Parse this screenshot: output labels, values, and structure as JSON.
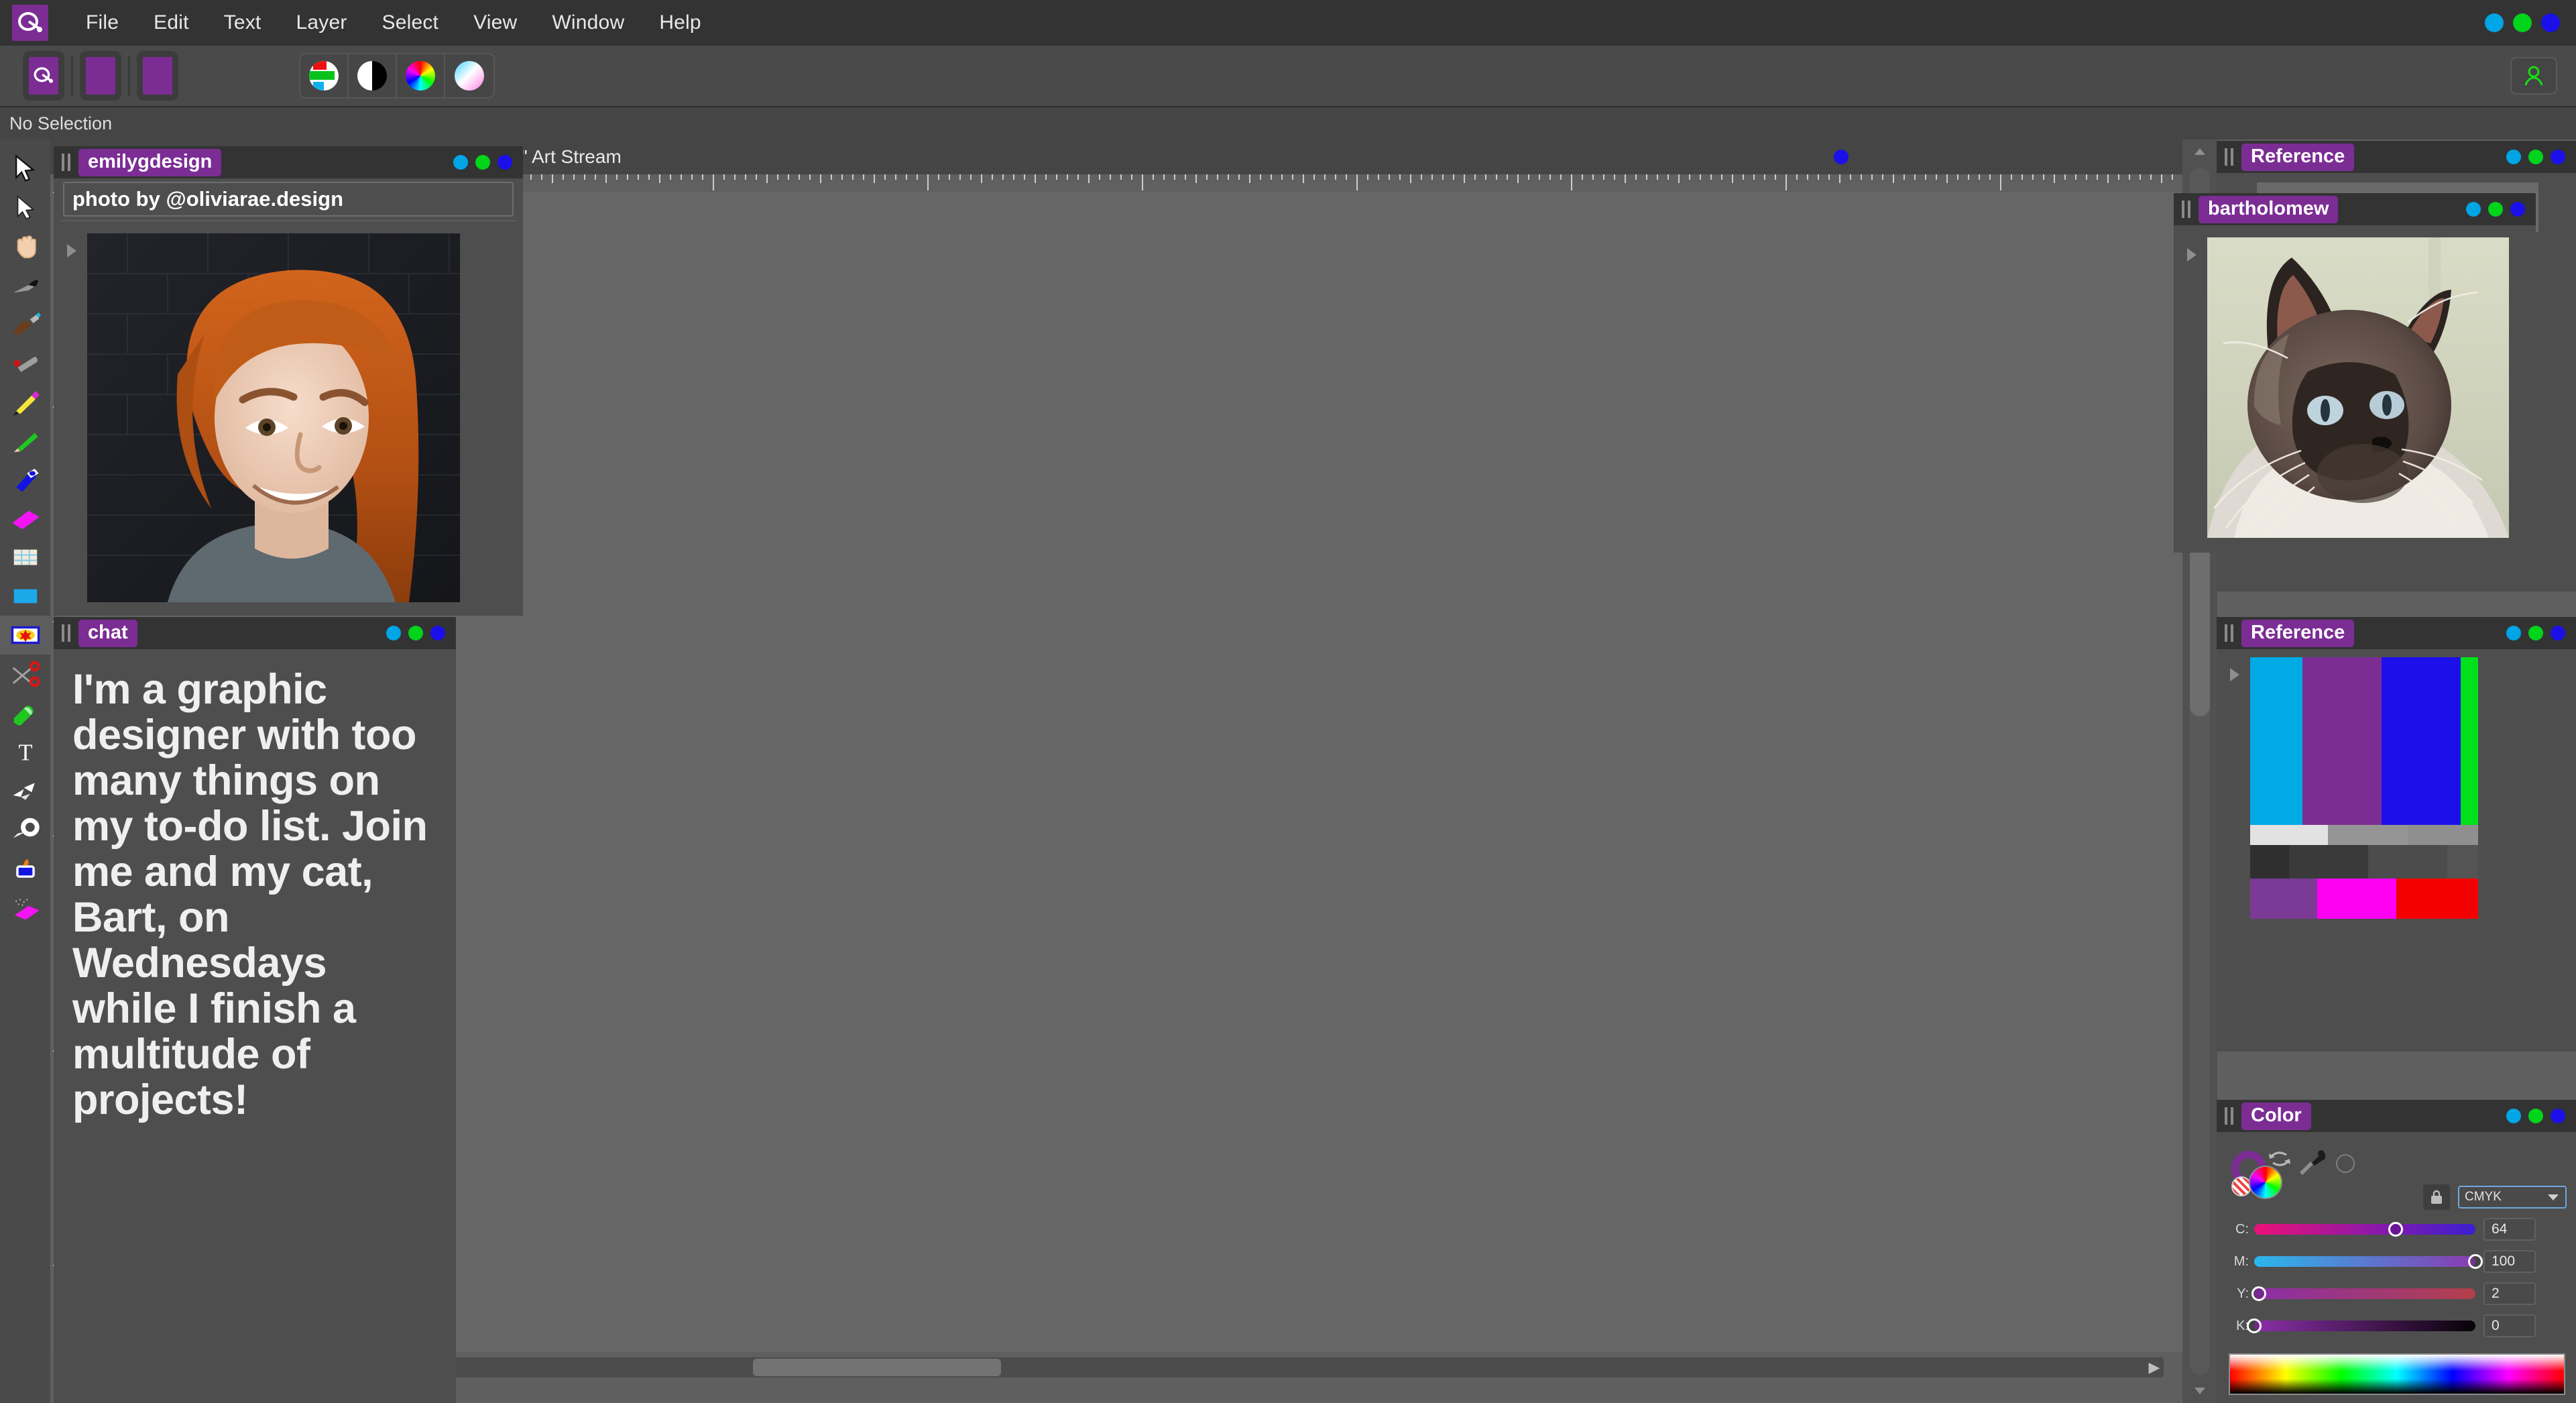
{
  "app": {
    "logo_icon": "e-plug-logo-icon",
    "menus": [
      "File",
      "Edit",
      "Text",
      "Layer",
      "Select",
      "View",
      "Window",
      "Help"
    ],
    "window_controls": [
      "minimize-dot",
      "maximize-dot",
      "close-dot"
    ],
    "accent": "#7b2d94",
    "dot_cyan": "#00a5e6",
    "dot_green": "#00d41b",
    "dot_blue": "#1b10ea"
  },
  "options_bar": {
    "presets": [
      "logo-preset",
      "purple-preset-1",
      "purple-preset-2"
    ],
    "color_modes": [
      "rgb-swatch-icon",
      "grayscale-icon",
      "color-wheel-icon",
      "gradient-icon"
    ],
    "user_icon": "user-account-icon"
  },
  "context_bar": {
    "selection_status": "No Selection"
  },
  "toolbar": {
    "tools": [
      "move-arrow-tool",
      "direct-select-arrow-tool",
      "hand-tool",
      "knife-tool",
      "paint-brush-tool",
      "charcoal-tool",
      "pencil-tool",
      "green-pencil-tool",
      "marker-tool",
      "magenta-chalk-tool",
      "grid-pattern-tool",
      "fill-rect-tool",
      "sticker-tool",
      "scissors-tool",
      "eraser-tool",
      "type-tool",
      "origami-tool",
      "lasso-tool",
      "ink-bottle-tool",
      "spray-tool"
    ],
    "selected": "sticker-tool"
  },
  "document": {
    "title": "al\" Art Stream",
    "ruler_units": "px",
    "window_controls": [
      "minimize-dot",
      "maximize-dot",
      "close-dot"
    ]
  },
  "panels": {
    "emily": {
      "title": "emilygdesign",
      "caption": "photo by @oliviarae.design",
      "media": "portrait-photo"
    },
    "chat": {
      "title": "chat",
      "message": "I'm a graphic designer with too many things on my to-do list. Join me and my cat, Bart, on Wednesdays while I finish a multitude of projects!"
    },
    "bartholomew": {
      "title": "bartholomew",
      "media": "cat-photo"
    },
    "reference_top": {
      "title": "Reference",
      "placeholder": ""
    },
    "reference_palette": {
      "title": "Reference",
      "swatches": [
        {
          "name": "cyan",
          "hex": "#00aae4"
        },
        {
          "name": "purple",
          "hex": "#7b2d94"
        },
        {
          "name": "blue",
          "hex": "#1b10ea"
        },
        {
          "name": "green",
          "hex": "#00e11b"
        },
        {
          "name": "near-white",
          "hex": "#e2e2e2"
        },
        {
          "name": "mid-gray",
          "hex": "#959595"
        },
        {
          "name": "gray",
          "hex": "#8f8f8f"
        },
        {
          "name": "dark-charcoal",
          "hex": "#2f2f2f"
        },
        {
          "name": "charcoal",
          "hex": "#3a3a3a"
        },
        {
          "name": "slate",
          "hex": "#4c4c4c"
        },
        {
          "name": "slate-2",
          "hex": "#545454"
        },
        {
          "name": "violet",
          "hex": "#7b3a96"
        },
        {
          "name": "magenta",
          "hex": "#ff00f2"
        },
        {
          "name": "red",
          "hex": "#f50000"
        }
      ]
    },
    "color": {
      "title": "Color",
      "mode": "CMYK",
      "lock_icon": "lock-icon",
      "eyedropper_icon": "eyedropper-icon",
      "swap_icon": "swap-colors-icon",
      "no-color_icon": "no-color-icon",
      "sliders": [
        {
          "label": "C:",
          "value": "64",
          "pct": 64
        },
        {
          "label": "M:",
          "value": "100",
          "pct": 100
        },
        {
          "label": "Y:",
          "value": "2",
          "pct": 2
        },
        {
          "label": "K:",
          "value": "0",
          "pct": 0
        }
      ],
      "spectrum": "color-spectrum-bar"
    }
  },
  "scrollbars": {
    "horizontal": "canvas-h-scrollbar",
    "vertical": "panel-v-scrollbar",
    "left_arrow": "◀",
    "right_arrow": "▶"
  }
}
